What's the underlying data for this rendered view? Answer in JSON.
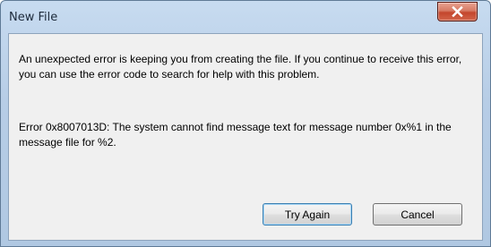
{
  "window": {
    "title": "New File"
  },
  "message": {
    "main": "An unexpected error is keeping you from creating the file. If you continue to receive this error, you can use the error code to search for help with this problem.",
    "error": "Error 0x8007013D: The system cannot find message text for message number 0x%1 in the message file for %2."
  },
  "buttons": {
    "try_again": "Try Again",
    "cancel": "Cancel"
  },
  "icons": {
    "close": "close-icon"
  },
  "colors": {
    "close_button": "#c4462c",
    "default_button_border": "#3c7fb1",
    "dialog_body": "#f0f0f0"
  }
}
